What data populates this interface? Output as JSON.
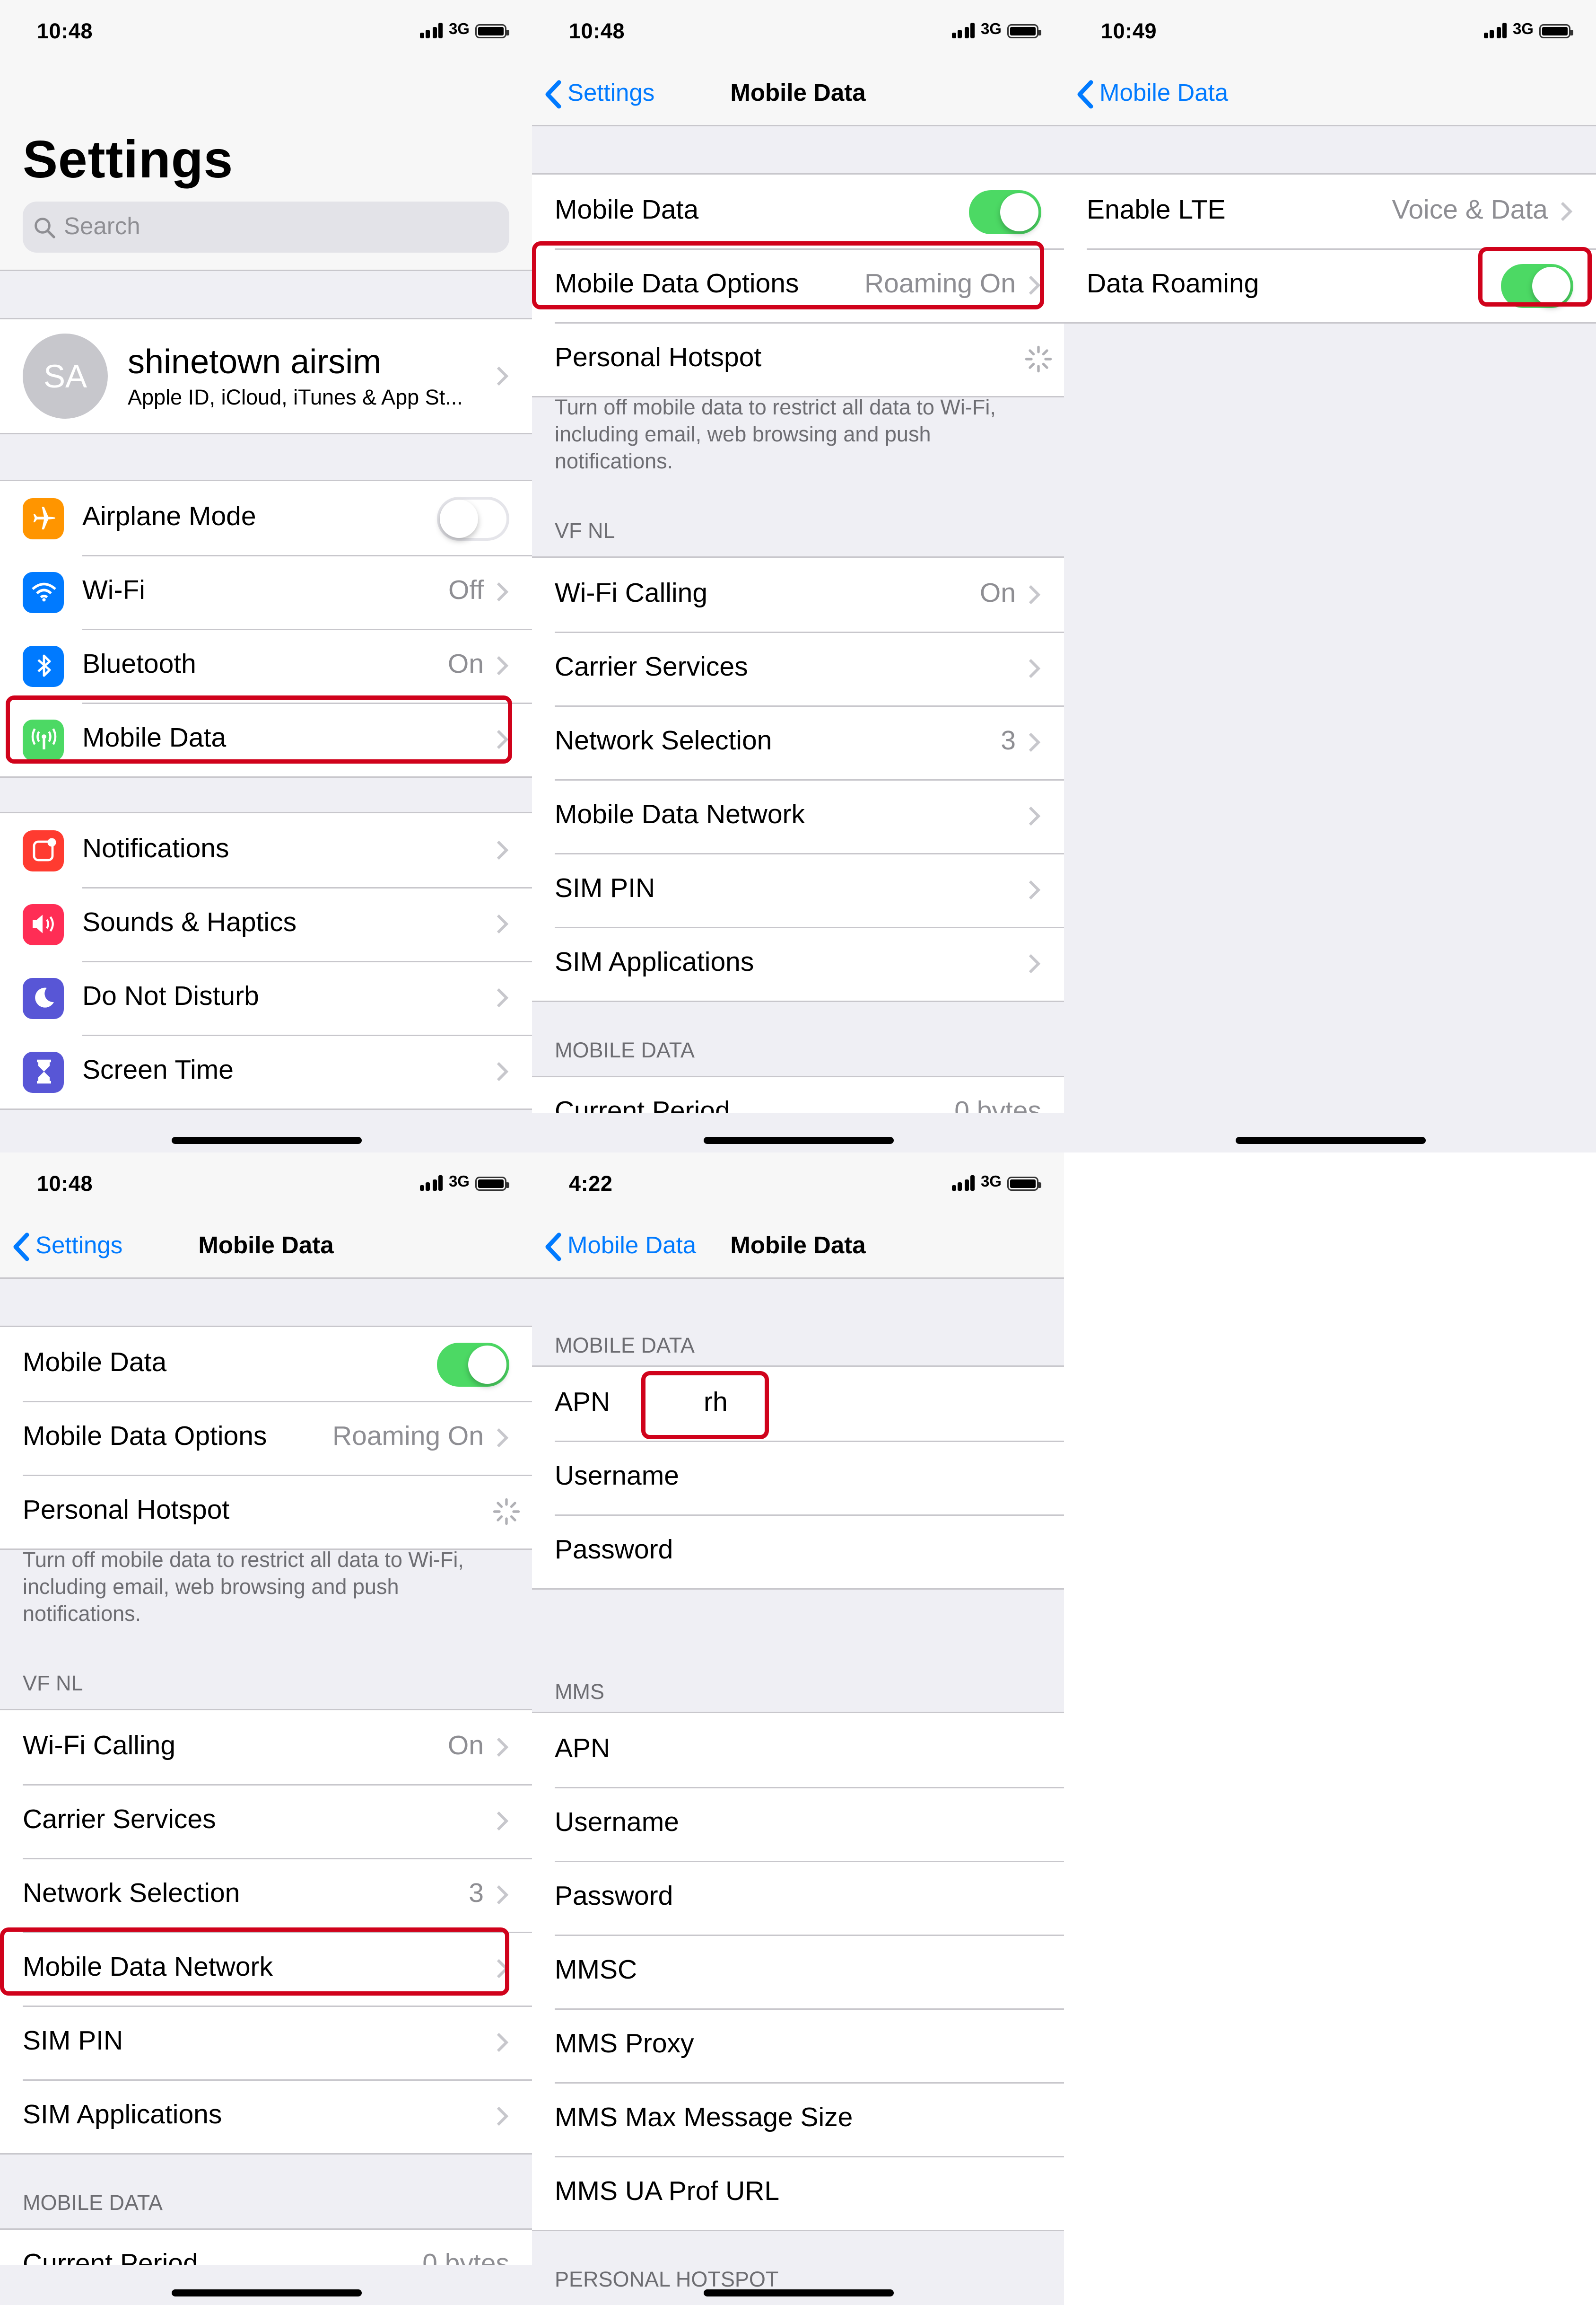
{
  "colors": {
    "accent": "#007aff",
    "toggle_on": "#4cd964",
    "highlight": "#d0021b",
    "secondary_text": "#8e8e93"
  },
  "screen1": {
    "time": "10:48",
    "network": "3G",
    "title": "Settings",
    "search_placeholder": "Search",
    "account": {
      "initials": "SA",
      "name": "shinetown airsim",
      "subtitle": "Apple ID, iCloud, iTunes & App St..."
    },
    "group1": [
      {
        "label": "Airplane Mode",
        "icon": "airplane-icon",
        "color": "#ff9500",
        "toggle": false
      },
      {
        "label": "Wi-Fi",
        "icon": "wifi-icon",
        "color": "#007aff",
        "value": "Off"
      },
      {
        "label": "Bluetooth",
        "icon": "bluetooth-icon",
        "color": "#007aff",
        "value": "On"
      },
      {
        "label": "Mobile Data",
        "icon": "antenna-icon",
        "color": "#4cd964",
        "highlighted": true
      }
    ],
    "group2": [
      {
        "label": "Notifications",
        "icon": "notifications-icon",
        "color": "#ff3b30"
      },
      {
        "label": "Sounds & Haptics",
        "icon": "speaker-icon",
        "color": "#ff2d55"
      },
      {
        "label": "Do Not Disturb",
        "icon": "moon-icon",
        "color": "#5856d6"
      },
      {
        "label": "Screen Time",
        "icon": "hourglass-icon",
        "color": "#5856d6"
      }
    ]
  },
  "screen2": {
    "time": "10:48",
    "network": "3G",
    "back": "Settings",
    "title": "Mobile Data",
    "top_rows": [
      {
        "label": "Mobile Data",
        "toggle": true
      },
      {
        "label": "Mobile Data Options",
        "value": "Roaming On"
      },
      {
        "label": "Personal Hotspot",
        "spinner": true
      }
    ],
    "footer": "Turn off mobile data to restrict all data to Wi-Fi, including email, web browsing and push notifications.",
    "carrier_header": "VF NL",
    "carrier_rows": [
      {
        "label": "Wi-Fi Calling",
        "value": "On"
      },
      {
        "label": "Carrier Services",
        "value": ""
      },
      {
        "label": "Network Selection",
        "value": "3"
      },
      {
        "label": "Mobile Data Network",
        "value": ""
      },
      {
        "label": "SIM PIN",
        "value": ""
      },
      {
        "label": "SIM Applications",
        "value": ""
      }
    ],
    "data_header": "MOBILE DATA",
    "current_period": "Current Period",
    "current_value": "0 bytes"
  },
  "screen3": {
    "time": "10:49",
    "network": "3G",
    "back": "Mobile Data",
    "rows": [
      {
        "label": "Enable LTE",
        "value": "Voice & Data"
      },
      {
        "label": "Data Roaming",
        "toggle": true
      }
    ]
  },
  "screen5": {
    "time": "4:22",
    "network": "3G",
    "back": "Mobile Data",
    "title": "Mobile Data",
    "mobile_header": "MOBILE DATA",
    "mobile_rows": [
      {
        "label": "APN",
        "value": "rh"
      },
      {
        "label": "Username"
      },
      {
        "label": "Password"
      }
    ],
    "mms_header": "MMS",
    "mms_rows": [
      "APN",
      "Username",
      "Password",
      "MMSC",
      "MMS Proxy",
      "MMS Max Message Size",
      "MMS UA Prof URL"
    ],
    "hotspot_header": "PERSONAL HOTSPOT"
  }
}
